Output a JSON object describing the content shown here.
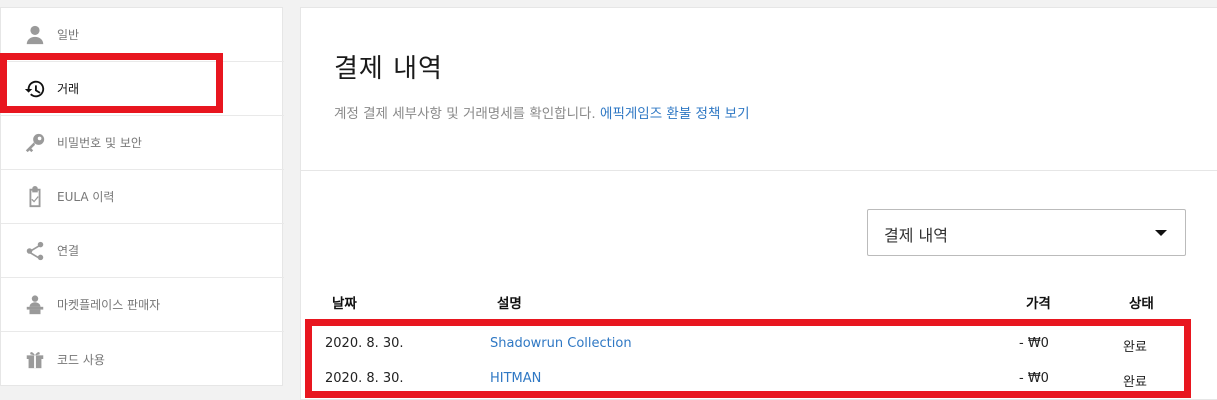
{
  "sidebar": {
    "items": [
      {
        "label": "일반",
        "icon": "person-icon"
      },
      {
        "label": "거래",
        "icon": "history-icon"
      },
      {
        "label": "비밀번호 및 보안",
        "icon": "key-icon"
      },
      {
        "label": "EULA 이력",
        "icon": "clipboard-check-icon"
      },
      {
        "label": "연결",
        "icon": "share-icon"
      },
      {
        "label": "마켓플레이스 판매자",
        "icon": "seller-icon"
      },
      {
        "label": "코드 사용",
        "icon": "gift-icon"
      }
    ]
  },
  "main": {
    "title": "결제 내역",
    "subtitle": "계정 결제 세부사항 및 거래명세를 확인합니다.",
    "refund_link": "에픽게임즈 환불 정책 보기",
    "filter": {
      "selected": "결제 내역"
    },
    "table": {
      "headers": {
        "date": "날짜",
        "description": "설명",
        "price": "가격",
        "status": "상태"
      },
      "rows": [
        {
          "date": "2020. 8. 30.",
          "description": "Shadowrun Collection",
          "price": "- ₩0",
          "status": "완료"
        },
        {
          "date": "2020. 8. 30.",
          "description": "HITMAN",
          "price": "- ₩0",
          "status": "완료"
        }
      ]
    }
  },
  "colors": {
    "highlight": "#e8161f",
    "link": "#2f78c4"
  }
}
